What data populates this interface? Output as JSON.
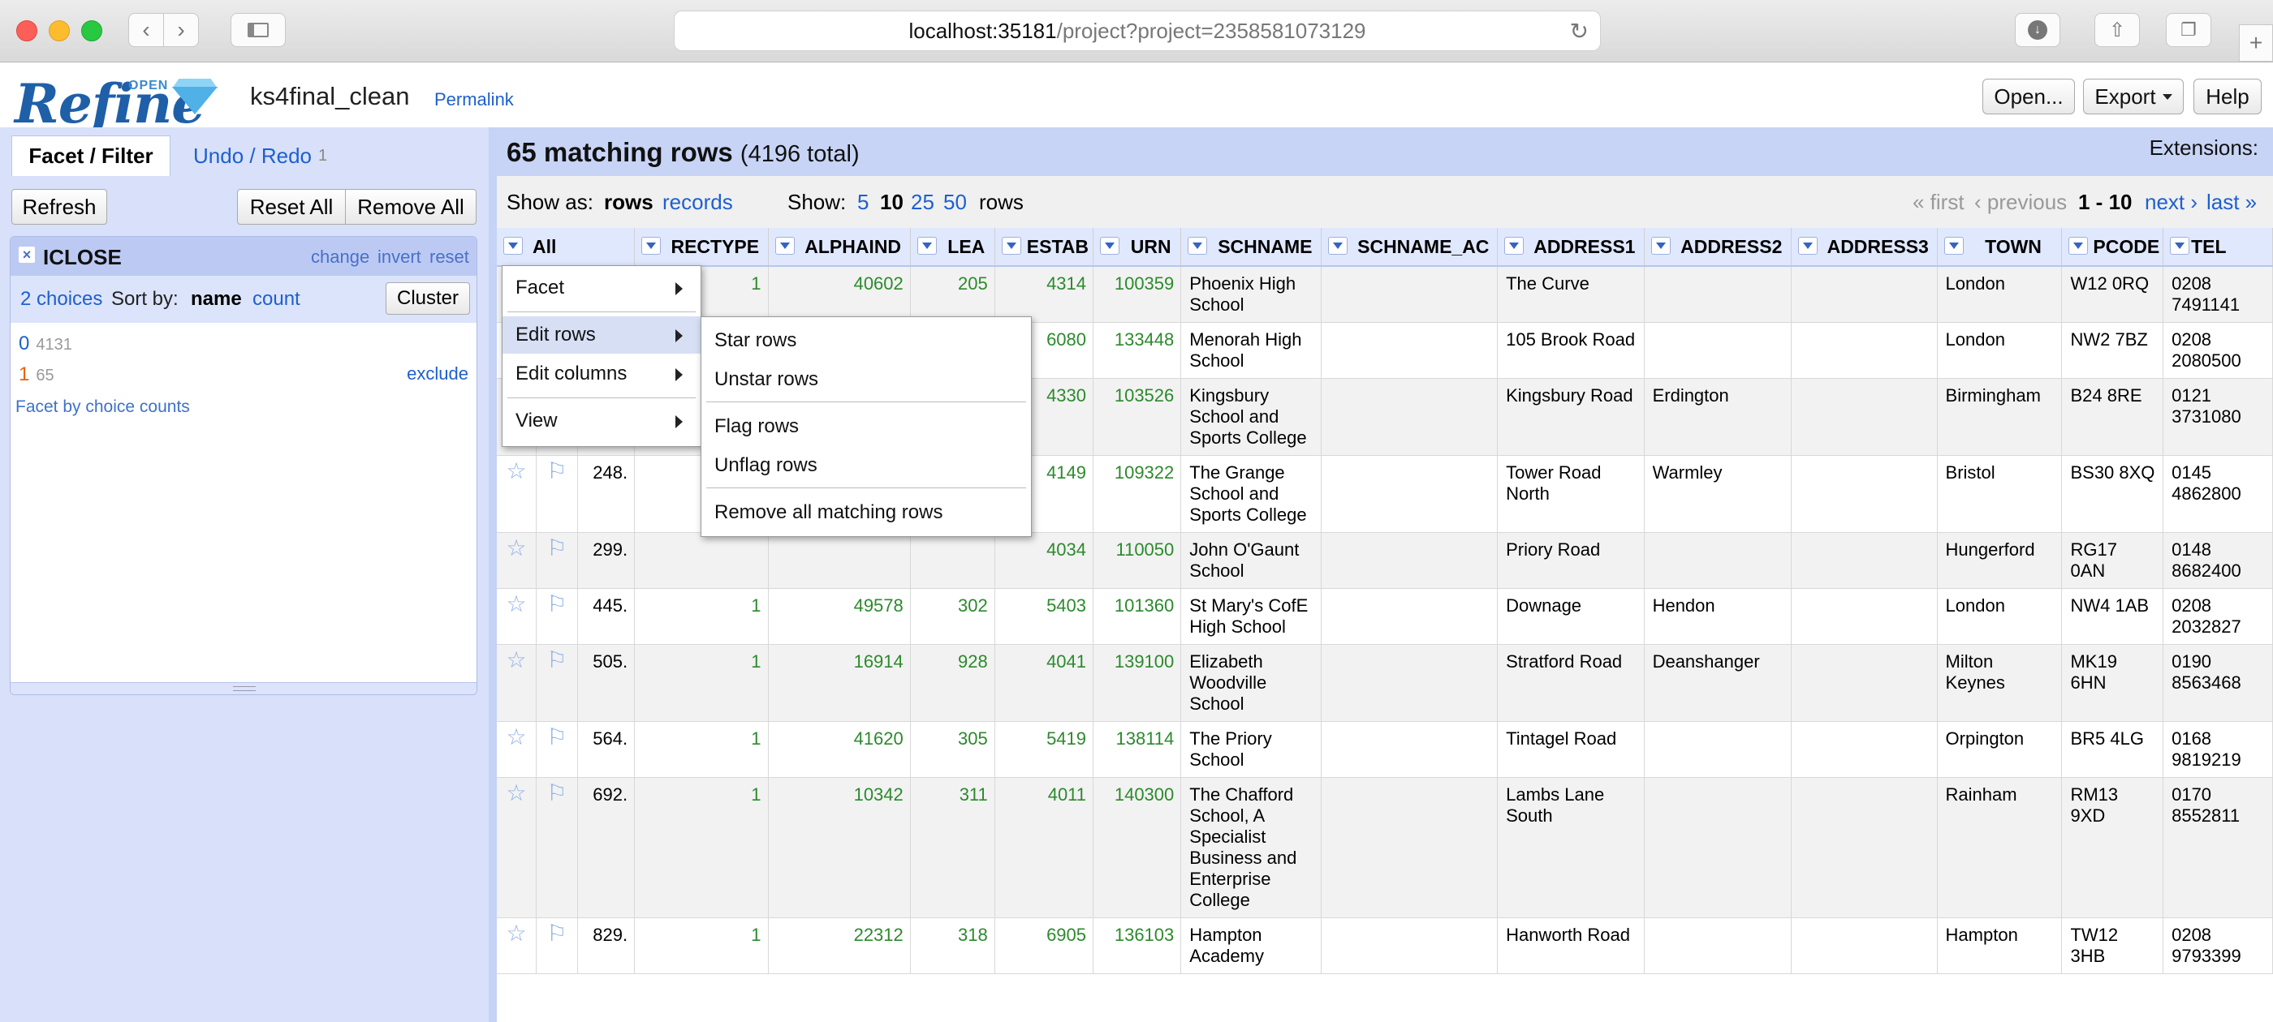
{
  "browser": {
    "url_host": "localhost:35181",
    "url_path": "/project?project=2358581073129"
  },
  "header": {
    "logo_text": "Refine",
    "logo_sup": "OPEN",
    "project_name": "ks4final_clean",
    "permalink": "Permalink",
    "open_btn": "Open...",
    "export_btn": "Export",
    "help_btn": "Help"
  },
  "left": {
    "tab_facet": "Facet / Filter",
    "tab_undo": "Undo / Redo",
    "undo_count": "1",
    "refresh": "Refresh",
    "reset_all": "Reset All",
    "remove_all": "Remove All",
    "facet": {
      "title": "ICLOSE",
      "change": "change",
      "invert": "invert",
      "reset": "reset",
      "choices": "2 choices",
      "sort_by": "Sort by:",
      "sort_name": "name",
      "sort_count": "count",
      "cluster": "Cluster",
      "items": [
        {
          "value": "0",
          "count": "4131"
        },
        {
          "value": "1",
          "count": "65"
        }
      ],
      "exclude": "exclude",
      "facet_by_counts": "Facet by choice counts"
    }
  },
  "summary": {
    "matching": "65 matching rows",
    "total": "(4196 total)",
    "extensions": "Extensions:"
  },
  "viewbar": {
    "show_as": "Show as:",
    "rows": "rows",
    "records": "records",
    "show": "Show:",
    "sizes": [
      "5",
      "10",
      "25",
      "50"
    ],
    "rows_suffix": "rows",
    "first": "« first",
    "previous": "‹ previous",
    "range": "1 - 10",
    "next": "next ›",
    "last": "last »"
  },
  "table": {
    "all_label": "All",
    "columns": [
      "RECTYPE",
      "ALPHAIND",
      "LEA",
      "ESTAB",
      "URN",
      "SCHNAME",
      "SCHNAME_AC",
      "ADDRESS1",
      "ADDRESS2",
      "ADDRESS3",
      "TOWN",
      "PCODE",
      "TEL"
    ],
    "rows": [
      {
        "idx": "",
        "rectype": "1",
        "alphaind": "40602",
        "lea": "205",
        "estab": "4314",
        "urn": "100359",
        "schname": "Phoenix High School",
        "addr1": "The Curve",
        "addr2": "",
        "town": "London",
        "pcode": "W12 0RQ",
        "tel": "0208 7491141"
      },
      {
        "idx": "",
        "rectype": "",
        "alphaind": "",
        "lea": "",
        "estab": "6080",
        "urn": "133448",
        "schname": "Menorah High School",
        "addr1": "105 Brook Road",
        "addr2": "",
        "town": "London",
        "pcode": "NW2 7BZ",
        "tel": "0208 2080500"
      },
      {
        "idx": "",
        "rectype": "",
        "alphaind": "",
        "lea": "",
        "estab": "4330",
        "urn": "103526",
        "schname": "Kingsbury School and Sports College",
        "addr1": "Kingsbury Road",
        "addr2": "Erdington",
        "town": "Birmingham",
        "pcode": "B24 8RE",
        "tel": "0121 3731080"
      },
      {
        "idx": "248.",
        "rectype": "",
        "alphaind": "",
        "lea": "",
        "estab": "4149",
        "urn": "109322",
        "schname": "The Grange School and Sports College",
        "addr1": "Tower Road North",
        "addr2": "Warmley",
        "town": "Bristol",
        "pcode": "BS30 8XQ",
        "tel": "0145 4862800"
      },
      {
        "idx": "299.",
        "rectype": "",
        "alphaind": "",
        "lea": "",
        "estab": "4034",
        "urn": "110050",
        "schname": "John O'Gaunt School",
        "addr1": "Priory Road",
        "addr2": "",
        "town": "Hungerford",
        "pcode": "RG17 0AN",
        "tel": "0148 8682400"
      },
      {
        "idx": "445.",
        "rectype": "1",
        "alphaind": "49578",
        "lea": "302",
        "estab": "5403",
        "urn": "101360",
        "schname": "St Mary's CofE High School",
        "addr1": "Downage",
        "addr2": "Hendon",
        "town": "London",
        "pcode": "NW4 1AB",
        "tel": "0208 2032827"
      },
      {
        "idx": "505.",
        "rectype": "1",
        "alphaind": "16914",
        "lea": "928",
        "estab": "4041",
        "urn": "139100",
        "schname": "Elizabeth Woodville School",
        "addr1": "Stratford Road",
        "addr2": "Deanshanger",
        "town": "Milton Keynes",
        "pcode": "MK19 6HN",
        "tel": "0190 8563468"
      },
      {
        "idx": "564.",
        "rectype": "1",
        "alphaind": "41620",
        "lea": "305",
        "estab": "5419",
        "urn": "138114",
        "schname": "The Priory School",
        "addr1": "Tintagel Road",
        "addr2": "",
        "town": "Orpington",
        "pcode": "BR5 4LG",
        "tel": "0168 9819219"
      },
      {
        "idx": "692.",
        "rectype": "1",
        "alphaind": "10342",
        "lea": "311",
        "estab": "4011",
        "urn": "140300",
        "schname": "The Chafford School, A Specialist Business and Enterprise College",
        "addr1": "Lambs Lane South",
        "addr2": "",
        "town": "Rainham",
        "pcode": "RM13 9XD",
        "tel": "0170 8552811"
      },
      {
        "idx": "829.",
        "rectype": "1",
        "alphaind": "22312",
        "lea": "318",
        "estab": "6905",
        "urn": "136103",
        "schname": "Hampton Academy",
        "addr1": "Hanworth Road",
        "addr2": "",
        "town": "Hampton",
        "pcode": "TW12 3HB",
        "tel": "0208 9793399"
      }
    ]
  },
  "menu_main": [
    "Facet",
    "Edit rows",
    "Edit columns",
    "View"
  ],
  "menu_sub": [
    "Star rows",
    "Unstar rows",
    "Flag rows",
    "Unflag rows",
    "Remove all matching rows"
  ]
}
